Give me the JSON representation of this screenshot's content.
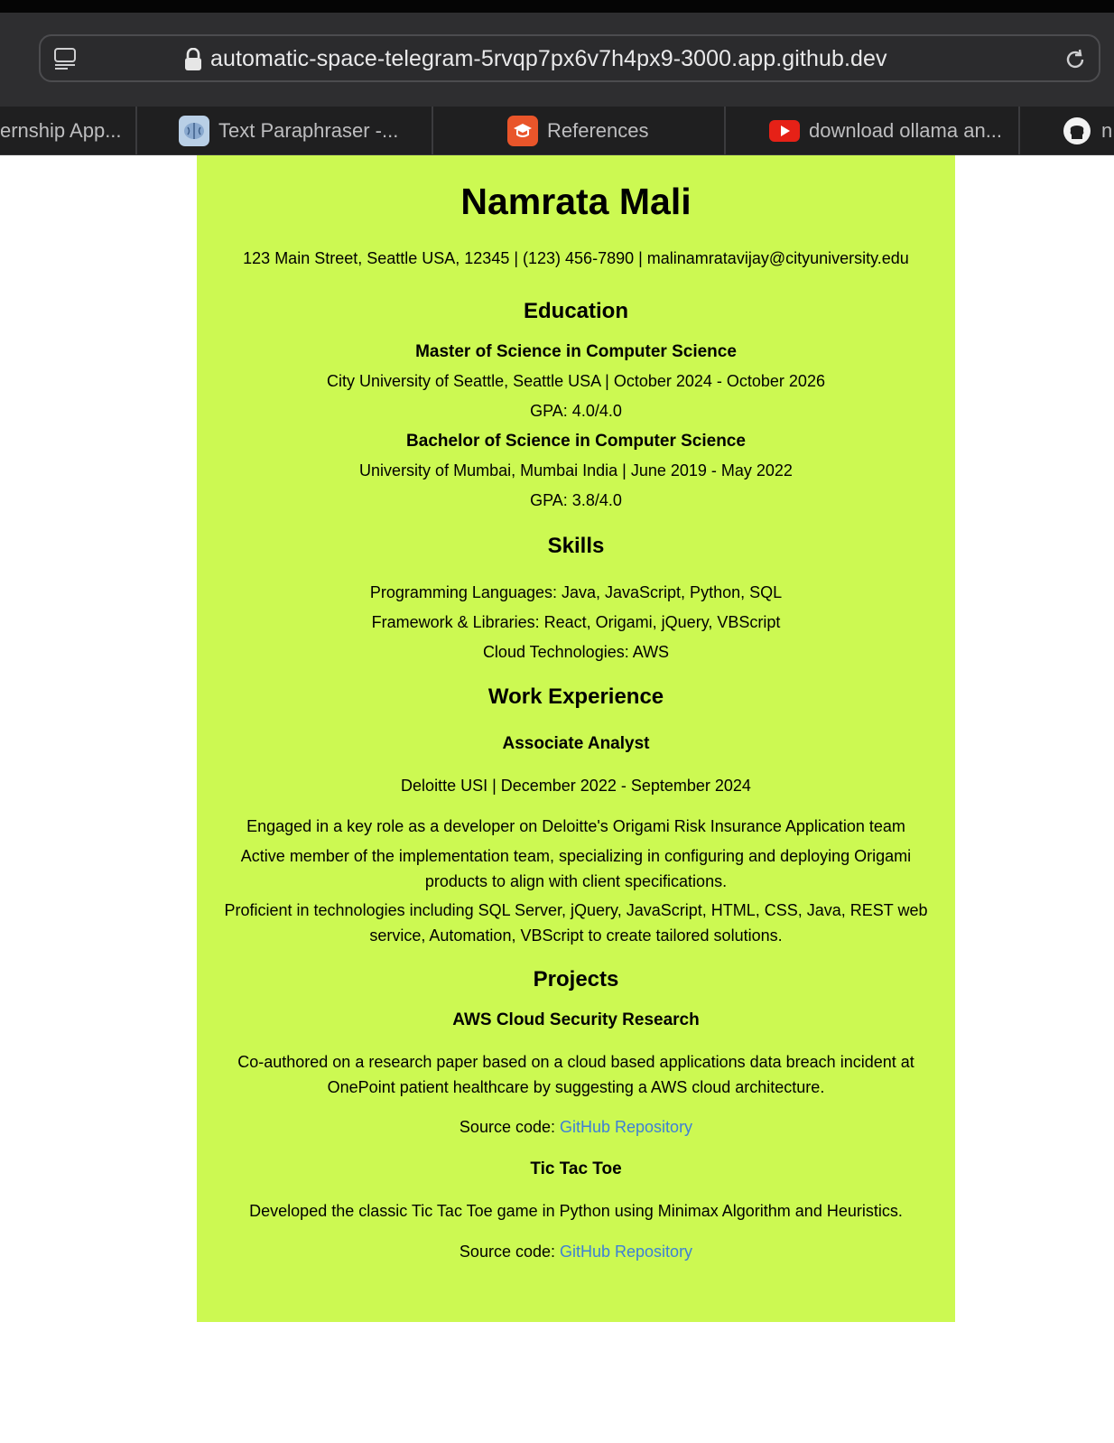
{
  "browser": {
    "url": "automatic-space-telegram-5rvqp7px6v7h4px9-3000.app.github.dev",
    "tabs": [
      {
        "label": "ernship App...",
        "icon": "page-icon"
      },
      {
        "label": "Text Paraphraser -...",
        "icon": "brain-icon"
      },
      {
        "label": "References",
        "icon": "graduation-cap-icon"
      },
      {
        "label": "download ollama an...",
        "icon": "youtube-icon"
      },
      {
        "label": "n",
        "icon": "github-icon"
      }
    ]
  },
  "resume": {
    "name": "Namrata Mali",
    "contact": "123 Main Street, Seattle USA, 12345 | (123) 456-7890 | malinamratavijay@cityuniversity.edu",
    "education": {
      "heading": "Education",
      "entries": [
        {
          "degree": "Master of Science in Computer Science",
          "school": "City University of Seattle, Seattle USA | October 2024 - October 2026",
          "gpa": "GPA: 4.0/4.0"
        },
        {
          "degree": "Bachelor of Science in Computer Science",
          "school": "University of Mumbai, Mumbai India | June 2019 - May 2022",
          "gpa": "GPA: 3.8/4.0"
        }
      ]
    },
    "skills": {
      "heading": "Skills",
      "items": [
        "Programming Languages: Java, JavaScript, Python, SQL",
        "Framework & Libraries: React, Origami, jQuery, VBScript",
        "Cloud Technologies: AWS"
      ]
    },
    "work": {
      "heading": "Work Experience",
      "title": "Associate Analyst",
      "company": "Deloitte USI | December 2022 - September 2024",
      "bullets": [
        "Engaged in a key role as a developer on Deloitte's Origami Risk Insurance Application team",
        "Active member of the implementation team, specializing in configuring and deploying Origami products to align with client specifications.",
        "Proficient in technologies including SQL Server, jQuery, JavaScript, HTML, CSS, Java, REST web service, Automation, VBScript to create tailored solutions."
      ]
    },
    "projects": {
      "heading": "Projects",
      "items": [
        {
          "title": "AWS Cloud Security Research",
          "description": "Co-authored on a research paper based on a cloud based applications data breach incident at OnePoint patient healthcare by suggesting a AWS cloud architecture.",
          "source_label": "Source code: ",
          "link_text": "GitHub Repository"
        },
        {
          "title": "Tic Tac Toe",
          "description": "Developed the classic Tic Tac Toe game in Python using Minimax Algorithm and Heuristics.",
          "source_label": "Source code: ",
          "link_text": "GitHub Repository"
        }
      ]
    }
  },
  "colors": {
    "resume_bg": "#ccf952",
    "link": "#3d7fd8",
    "chrome_bg": "#2e2e30"
  }
}
